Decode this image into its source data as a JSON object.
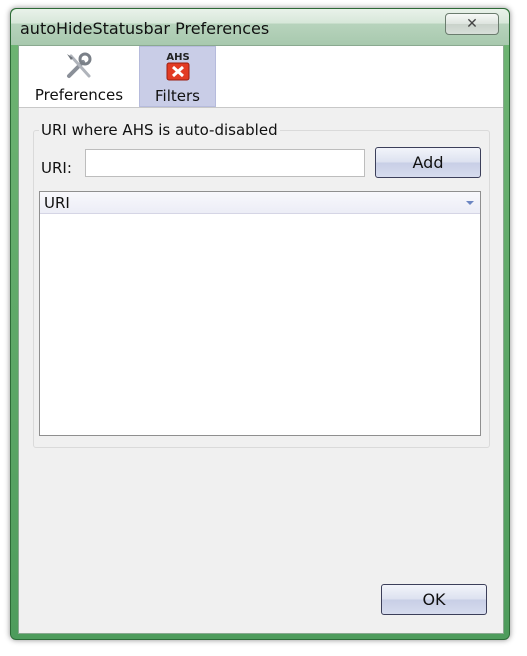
{
  "window": {
    "title": "autoHideStatusbar Preferences",
    "close_glyph": "✕"
  },
  "toolbar": {
    "items": [
      {
        "label": "Preferences",
        "icon": "tools-icon",
        "selected": false
      },
      {
        "label": "Filters",
        "icon": "ahs-disabled-icon",
        "icon_text": "AHS",
        "selected": true
      }
    ]
  },
  "filters": {
    "group_caption": "URI where AHS is auto-disabled",
    "uri_label": "URI:",
    "uri_value": "",
    "uri_placeholder": "",
    "add_label": "Add",
    "list_columns": [
      "URI"
    ],
    "list_rows": []
  },
  "dialog": {
    "ok_label": "OK"
  },
  "colors": {
    "frame": "#5aa563",
    "selected_tab": "#c9cde7",
    "button": "#d7dcee",
    "accent_close": "#e23b24"
  }
}
